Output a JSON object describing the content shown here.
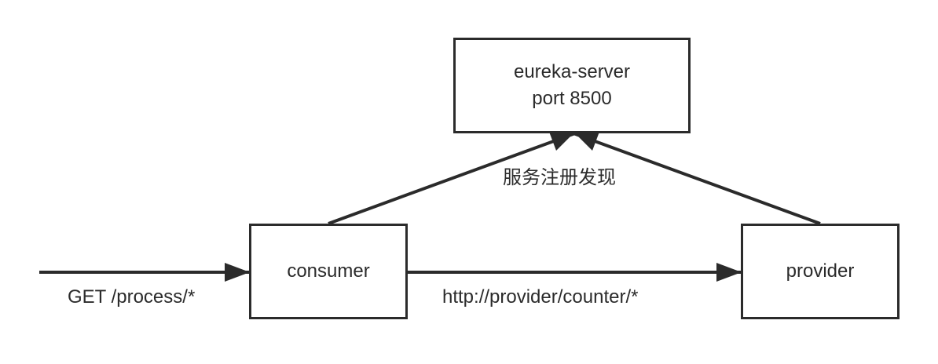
{
  "nodes": {
    "eureka": {
      "line1": "eureka-server",
      "line2": "port 8500"
    },
    "consumer": {
      "label": "consumer"
    },
    "provider": {
      "label": "provider"
    }
  },
  "edges": {
    "registration": {
      "label": "服务注册发现"
    },
    "incoming": {
      "label": "GET /process/*"
    },
    "call": {
      "label": "http://provider/counter/*"
    }
  },
  "colors": {
    "stroke": "#2b2b2b",
    "background": "#ffffff"
  }
}
